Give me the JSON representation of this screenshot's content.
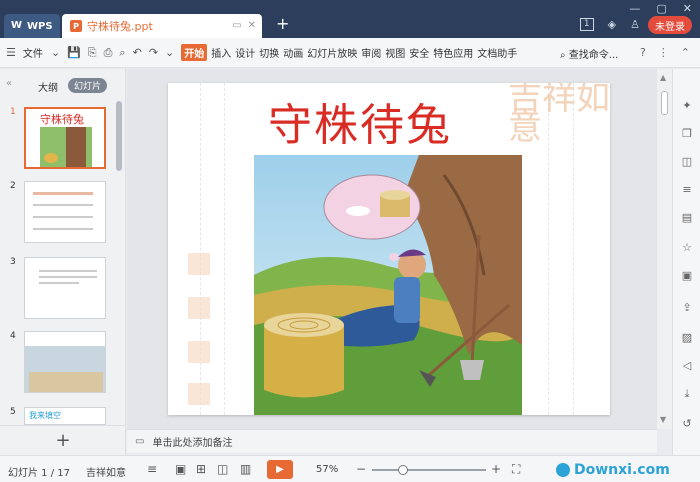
{
  "titlebar": {
    "app_name": "WPS",
    "doc_tab_title": "守株待兔.ppt",
    "login_label": "未登录",
    "badge_count": "1"
  },
  "toolbar": {
    "file_menu": "文件",
    "tabs": [
      "开始",
      "插入",
      "设计",
      "切换",
      "动画",
      "幻灯片放映",
      "审阅",
      "视图",
      "安全",
      "特色应用",
      "文档助手"
    ],
    "search_cmd": "查找命令..."
  },
  "leftpanel": {
    "tab_outline": "大纲",
    "tab_slides": "幻灯片",
    "slide_numbers": [
      "1",
      "2",
      "3",
      "4",
      "5"
    ],
    "thumb1_title": "守株待兔",
    "thumb5_label": "我来填空"
  },
  "slide": {
    "title": "守株待兔",
    "seal_text": "吉祥如意"
  },
  "notes": {
    "placeholder": "单击此处添加备注"
  },
  "statusbar": {
    "slide_info": "幻灯片 1 / 17",
    "theme_name": "吉祥如意",
    "zoom": "57%",
    "zoom_fraction": 0.27
  },
  "watermark": {
    "text": "Downxi.com"
  },
  "colors": {
    "accent": "#e76a35",
    "titlebar_bg": "#2c3e5c",
    "login_bg": "#e34b3c",
    "slide_title": "#d92c24"
  }
}
